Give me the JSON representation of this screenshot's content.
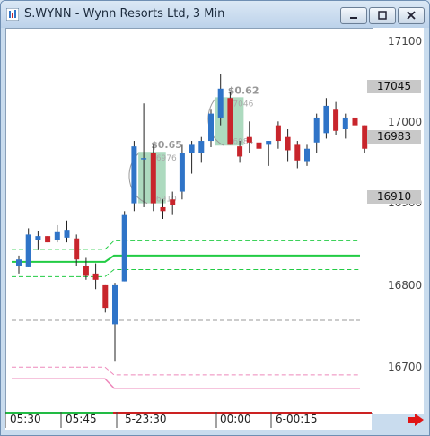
{
  "window": {
    "title": "S.WYNN - Wynn Resorts Ltd, 3 Min",
    "icon": "chart-app-icon",
    "controls": [
      "minimize",
      "maximize",
      "close"
    ]
  },
  "price_axis": {
    "labels": [
      "17100",
      "17000",
      "16900",
      "16800",
      "16700"
    ],
    "boxes": [
      "17045",
      "16983",
      "16910"
    ]
  },
  "time_axis": {
    "labels": [
      "05:30",
      "05:45",
      "5-23:30",
      "00:00",
      "6-00:15"
    ]
  },
  "trades": [
    {
      "pnl": "$0.65",
      "entry": "16976",
      "exit": "16910"
    },
    {
      "pnl": "$0.62",
      "entry": "17046",
      "exit": "16984"
    }
  ],
  "colors": {
    "up": "#2f74c8",
    "down": "#c8252c",
    "profit_box": "#9fd4b4",
    "line_green": "#22cc44",
    "line_pink": "#ee88bb",
    "line_gray": "#999999"
  },
  "chart_data": {
    "type": "candlestick",
    "ylim": [
      16660,
      17120
    ],
    "y_ticks": [
      16700,
      16800,
      16900,
      17000,
      17100
    ],
    "lines": [
      {
        "name": "green-solid",
        "value_left": 16835,
        "value_right": 16843
      },
      {
        "name": "green-dashed-upper",
        "value_left": 16851,
        "value_right": 16862
      },
      {
        "name": "green-dashed-lower",
        "value_left": 16816,
        "value_right": 16825
      },
      {
        "name": "gray-dashed",
        "value": 16760
      },
      {
        "name": "pink-solid",
        "value_left": 16685,
        "value_right": 16673
      },
      {
        "name": "pink-dashed",
        "value_left": 16700,
        "value_right": 16690
      }
    ],
    "candles": [
      {
        "o": 16830,
        "h": 16843,
        "l": 16820,
        "c": 16838
      },
      {
        "o": 16828,
        "h": 16878,
        "l": 16828,
        "c": 16870
      },
      {
        "o": 16863,
        "h": 16875,
        "l": 16850,
        "c": 16868
      },
      {
        "o": 16868,
        "h": 16868,
        "l": 16860,
        "c": 16860
      },
      {
        "o": 16863,
        "h": 16882,
        "l": 16860,
        "c": 16873
      },
      {
        "o": 16866,
        "h": 16888,
        "l": 16860,
        "c": 16876
      },
      {
        "o": 16865,
        "h": 16870,
        "l": 16830,
        "c": 16838
      },
      {
        "o": 16830,
        "h": 16840,
        "l": 16812,
        "c": 16817
      },
      {
        "o": 16820,
        "h": 16833,
        "l": 16800,
        "c": 16812
      },
      {
        "o": 16805,
        "h": 16805,
        "l": 16770,
        "c": 16776
      },
      {
        "o": 16755,
        "h": 16807,
        "l": 16708,
        "c": 16805
      },
      {
        "o": 16810,
        "h": 16900,
        "l": 16810,
        "c": 16895
      },
      {
        "o": 16910,
        "h": 16990,
        "l": 16900,
        "c": 16983
      },
      {
        "o": 16968,
        "h": 17038,
        "l": 16905,
        "c": 16968
      },
      {
        "o": 16975,
        "h": 16985,
        "l": 16900,
        "c": 16910
      },
      {
        "o": 16905,
        "h": 16915,
        "l": 16890,
        "c": 16900
      },
      {
        "o": 16915,
        "h": 16925,
        "l": 16895,
        "c": 16908
      },
      {
        "o": 16925,
        "h": 16985,
        "l": 16915,
        "c": 16975
      },
      {
        "o": 16975,
        "h": 16990,
        "l": 16948,
        "c": 16985
      },
      {
        "o": 16975,
        "h": 16995,
        "l": 16962,
        "c": 16990
      },
      {
        "o": 16990,
        "h": 17030,
        "l": 16982,
        "c": 17025
      },
      {
        "o": 17020,
        "h": 17076,
        "l": 17010,
        "c": 17057
      },
      {
        "o": 17045,
        "h": 17053,
        "l": 16985,
        "c": 16985
      },
      {
        "o": 16983,
        "h": 16990,
        "l": 16962,
        "c": 16970
      },
      {
        "o": 16995,
        "h": 17015,
        "l": 16975,
        "c": 16988
      },
      {
        "o": 16988,
        "h": 17000,
        "l": 16970,
        "c": 16980
      },
      {
        "o": 16985,
        "h": 16990,
        "l": 16958,
        "c": 16990
      },
      {
        "o": 17010,
        "h": 17015,
        "l": 16980,
        "c": 16990
      },
      {
        "o": 16995,
        "h": 17005,
        "l": 16963,
        "c": 16978
      },
      {
        "o": 16985,
        "h": 16990,
        "l": 16955,
        "c": 16965
      },
      {
        "o": 16963,
        "h": 16985,
        "l": 16958,
        "c": 16980
      },
      {
        "o": 16988,
        "h": 17025,
        "l": 16975,
        "c": 17020
      },
      {
        "o": 17000,
        "h": 17045,
        "l": 16993,
        "c": 17035
      },
      {
        "o": 17030,
        "h": 17040,
        "l": 16998,
        "c": 17003
      },
      {
        "o": 17005,
        "h": 17025,
        "l": 16993,
        "c": 17020
      },
      {
        "o": 17020,
        "h": 17032,
        "l": 17008,
        "c": 17010
      },
      {
        "o": 17010,
        "h": 17010,
        "l": 16975,
        "c": 16980
      }
    ]
  }
}
